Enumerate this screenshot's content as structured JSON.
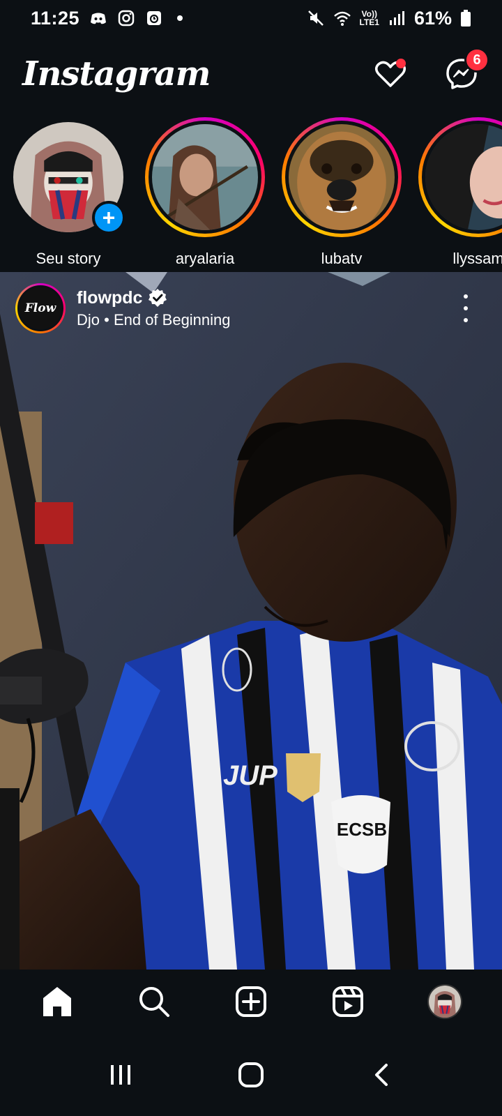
{
  "status_bar": {
    "time": "11:25",
    "battery": "61%",
    "network": "LTE1"
  },
  "header": {
    "logo": "Instagram",
    "messages_badge": "6"
  },
  "stories": [
    {
      "label": "Seu story",
      "own": true
    },
    {
      "label": "aryalaria",
      "own": false
    },
    {
      "label": "lubatv",
      "own": false
    },
    {
      "label": "llyssam",
      "own": false
    }
  ],
  "post": {
    "username": "flowpdc",
    "verified": true,
    "subtitle": "Djo • End of Beginning",
    "avatar_text": "Flow"
  },
  "bottom_nav": {
    "items": [
      "home",
      "search",
      "create",
      "reels",
      "profile"
    ]
  },
  "colors": {
    "background": "#0c1014",
    "notification_red": "#ff3040",
    "story_add_blue": "#0095f6"
  }
}
